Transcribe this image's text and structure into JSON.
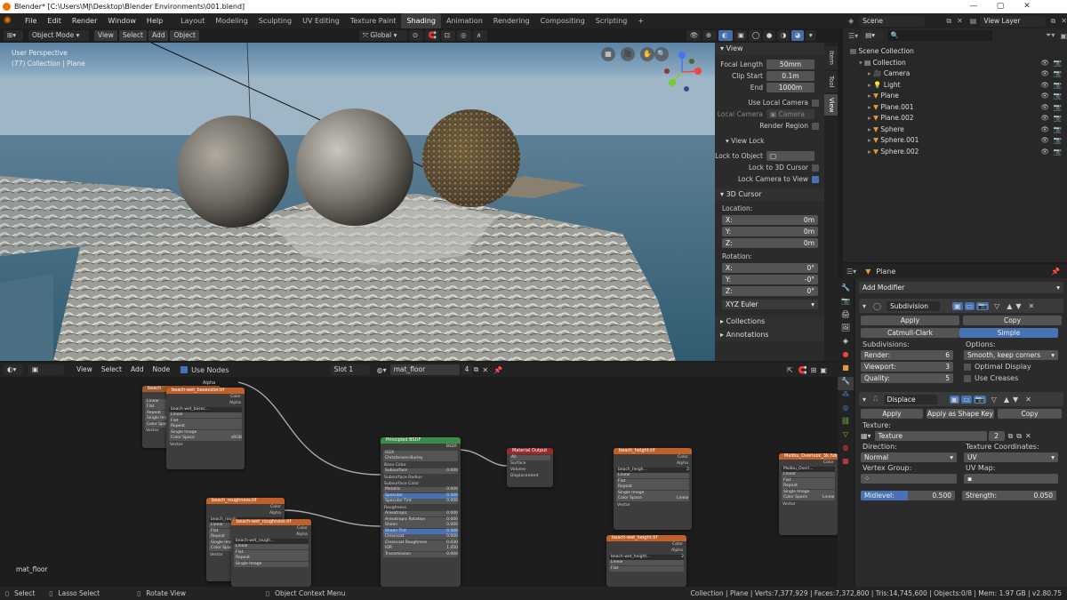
{
  "window": {
    "title": "Blender* [C:\\Users\\MJ\\Desktop\\Blender Environments\\001.blend]"
  },
  "menu": [
    "File",
    "Edit",
    "Render",
    "Window",
    "Help"
  ],
  "workspaces": [
    "Layout",
    "Modeling",
    "Sculpting",
    "UV Editing",
    "Texture Paint",
    "Shading",
    "Animation",
    "Rendering",
    "Compositing",
    "Scripting"
  ],
  "active_workspace": "Shading",
  "scene": {
    "name": "Scene",
    "view_layer": "View Layer"
  },
  "viewport": {
    "mode": "Object Mode",
    "menus": [
      "View",
      "Select",
      "Add",
      "Object"
    ],
    "orientation": "Global",
    "overlay_line1": "User Perspective",
    "overlay_line2": "(77) Collection | Plane"
  },
  "npanel": {
    "tabs": [
      "Item",
      "Tool",
      "View"
    ],
    "view_title": "View",
    "focal_label": "Focal Length",
    "focal": "50mm",
    "clip_start_label": "Clip Start",
    "clip_start": "0.1m",
    "end_label": "End",
    "end": "1000m",
    "use_local_camera": "Use Local Camera",
    "local_camera_label": "Local Camera",
    "local_camera": "Camera",
    "render_region": "Render Region",
    "view_lock_title": "View Lock",
    "lock_to_object": "Lock to Object",
    "lock_3d_cursor": "Lock to 3D Cursor",
    "lock_camera": "Lock Camera to View",
    "cursor_title": "3D Cursor",
    "location": "Location:",
    "x": "X:",
    "y": "Y:",
    "z": "Z:",
    "loc_x": "0m",
    "loc_y": "0m",
    "loc_z": "0m",
    "rotation": "Rotation:",
    "rot_x": "0°",
    "rot_y": "-0°",
    "rot_z": "0°",
    "rot_mode": "XYZ Euler",
    "collections": "Collections",
    "annotations": "Annotations"
  },
  "outliner": {
    "scene_collection": "Scene Collection",
    "items": [
      {
        "name": "Collection",
        "indent": 1
      },
      {
        "name": "Camera",
        "indent": 2
      },
      {
        "name": "Light",
        "indent": 2
      },
      {
        "name": "Plane",
        "indent": 2
      },
      {
        "name": "Plane.001",
        "indent": 2
      },
      {
        "name": "Plane.002",
        "indent": 2
      },
      {
        "name": "Sphere",
        "indent": 2
      },
      {
        "name": "Sphere.001",
        "indent": 2
      },
      {
        "name": "Sphere.002",
        "indent": 2
      }
    ]
  },
  "properties": {
    "object": "Plane",
    "add_modifier": "Add Modifier",
    "subdiv": {
      "name": "Subdivision",
      "apply": "Apply",
      "copy": "Copy",
      "catmull": "Catmull-Clark",
      "simple": "Simple",
      "subdivisions": "Subdivisions:",
      "render_label": "Render:",
      "render": "6",
      "viewport_label": "Viewport:",
      "viewport": "3",
      "quality_label": "Quality:",
      "quality": "5",
      "options": "Options:",
      "smooth": "Smooth, keep corners",
      "optimal": "Optimal Display",
      "creases": "Use Creases"
    },
    "displace": {
      "name": "Displace",
      "apply": "Apply",
      "apply_shape": "Apply as Shape Key",
      "copy": "Copy",
      "texture_label": "Texture:",
      "texture": "Texture",
      "texture_users": "2",
      "direction_label": "Direction:",
      "direction": "Normal",
      "coords_label": "Texture Coordinates:",
      "coords": "UV",
      "vgroup_label": "Vertex Group:",
      "uvmap_label": "UV Map:",
      "midlevel_label": "Midlevel:",
      "midlevel": "0.500",
      "strength_label": "Strength:",
      "strength": "0.050"
    }
  },
  "node_editor": {
    "type": "Object",
    "menus": [
      "View",
      "Select",
      "Add",
      "Node"
    ],
    "use_nodes": "Use Nodes",
    "slot": "Slot 1",
    "material": "mat_floor",
    "users": "4",
    "label": "mat_floor",
    "nodes": {
      "basecolor": {
        "title": "beach-wet_basecolor.tif",
        "back_title": "beach",
        "file": "beach-wet_basec...",
        "colorspace": "sRGB"
      },
      "rough": {
        "title": "beach_roughness.tif",
        "back_title": "beach_rough...",
        "front_title": "beach-wet_roughness.tif",
        "file": "beach-wet_rough..."
      },
      "bsdf": {
        "title": "Principled BSDF",
        "out": "BSDF",
        "dist": "GGX",
        "sss": "Christensen-Burley",
        "rows": [
          [
            "Base Color",
            ""
          ],
          [
            "Subsurface",
            "0.000"
          ],
          [
            "Subsurface Radius",
            ""
          ],
          [
            "Subsurface Color",
            ""
          ],
          [
            "Metallic",
            "0.000"
          ],
          [
            "Specular",
            "0.500"
          ],
          [
            "Specular Tint",
            "0.000"
          ],
          [
            "Roughness",
            ""
          ],
          [
            "Anisotropic",
            "0.000"
          ],
          [
            "Anisotropic Rotation",
            "0.000"
          ],
          [
            "Sheen",
            "0.000"
          ],
          [
            "Sheen Tint",
            "0.500"
          ],
          [
            "Clearcoat",
            "0.000"
          ],
          [
            "Clearcoat Roughness",
            "0.030"
          ],
          [
            "IOR",
            "1.450"
          ],
          [
            "Transmission",
            "0.000"
          ]
        ]
      },
      "output": {
        "title": "Material Output",
        "target": "All",
        "rows": [
          "Surface",
          "Volume",
          "Displacement"
        ]
      },
      "height1": {
        "title": "beach_height.tif",
        "file": "beach_heigh...",
        "users": "2",
        "colorspace": "Linear"
      },
      "height2": {
        "title": "beach-wet_height.tif",
        "file": "beach-wet_height...",
        "users": "2"
      },
      "malibu": {
        "title": "Malibu_Overlook_3k.hdr",
        "file": "Malibu_Overl...",
        "colorspace": "Linear"
      },
      "labels": {
        "color": "Color",
        "alpha": "Alpha",
        "linear": "Linear",
        "flat": "Flat",
        "repeat": "Repeat",
        "single": "Single Image",
        "colorspace": "Color Space",
        "vector": "Vector"
      }
    }
  },
  "statusbar": {
    "select": "Select",
    "lasso": "Lasso Select",
    "rotate": "Rotate View",
    "context": "Object Context Menu",
    "stats": "Collection | Plane | Verts:7,377,929 | Faces:7,372,800 | Tris:14,745,600 | Objects:0/8 | Mem: 1.97 GB | v2.80.75"
  },
  "colors": {
    "accent": "#4772b3",
    "header": "#232323",
    "panel": "#2b2b2b"
  }
}
